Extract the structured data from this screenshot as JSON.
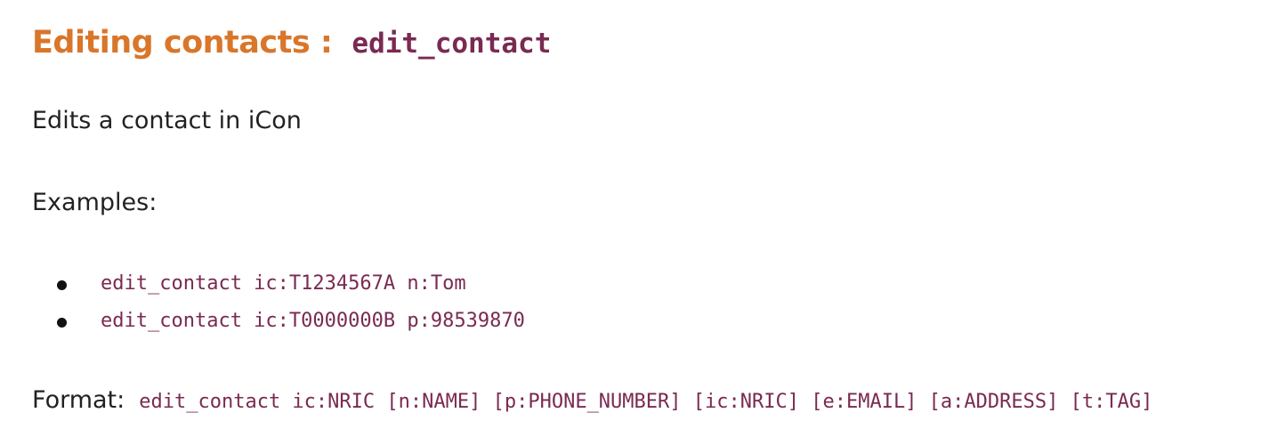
{
  "heading": {
    "title": "Editing contacts :",
    "command": "edit_contact"
  },
  "description": "Edits a contact in iCon",
  "examples": {
    "label": "Examples:",
    "items": [
      "edit_contact ic:T1234567A n:Tom",
      "edit_contact ic:T0000000B p:98539870"
    ]
  },
  "format": {
    "label": "Format:",
    "syntax": "edit_contact ic:NRIC [n:NAME] [p:PHONE_NUMBER] [ic:NRIC] [e:EMAIL] [a:ADDRESS] [t:TAG]"
  },
  "colors": {
    "heading": "#d9762a",
    "code": "#7a2a52",
    "text": "#222222"
  }
}
